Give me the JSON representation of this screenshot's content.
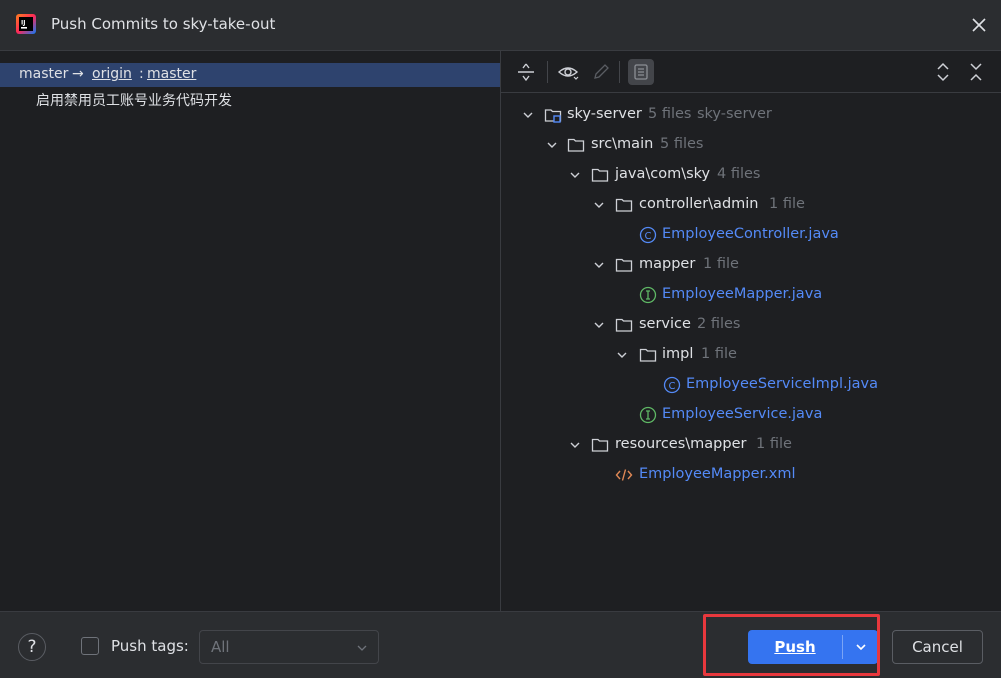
{
  "window": {
    "title": "Push Commits to sky-take-out",
    "logo_icon": "intellij-idea-logo"
  },
  "commits": {
    "branch": {
      "local": "master",
      "arrow": "→",
      "remote": "origin",
      "separator": ":",
      "remote_branch": "master"
    },
    "message": "启用禁用员工账号业务代码开发"
  },
  "toolbar": {
    "icons": [
      "collapse-to-line-icon",
      "eye-icon",
      "pencil-icon",
      "list-view-icon",
      "expand-all-icon",
      "collapse-all-icon"
    ]
  },
  "tree": {
    "module": {
      "name": "sky-server",
      "count": "5 files",
      "extra": "sky-server"
    },
    "src_main": {
      "name": "src\\main",
      "count": "5 files"
    },
    "java_pkg": {
      "name": "java\\com\\sky",
      "count": "4 files"
    },
    "controller": {
      "name": "controller\\admin",
      "count": "1 file"
    },
    "employee_controller": {
      "name": "EmployeeController.java",
      "kind": "class"
    },
    "mapper_dir": {
      "name": "mapper",
      "count": "1 file"
    },
    "employee_mapper": {
      "name": "EmployeeMapper.java",
      "kind": "interface"
    },
    "service_dir": {
      "name": "service",
      "count": "2 files"
    },
    "impl_dir": {
      "name": "impl",
      "count": "1 file"
    },
    "employee_service_impl": {
      "name": "EmployeeServiceImpl.java",
      "kind": "class"
    },
    "employee_service": {
      "name": "EmployeeService.java",
      "kind": "interface"
    },
    "resources_mapper": {
      "name": "resources\\mapper",
      "count": "1 file"
    },
    "employee_mapper_xml": {
      "name": "EmployeeMapper.xml",
      "kind": "xml"
    }
  },
  "footer": {
    "help": "?",
    "push_tags_label": "Push tags:",
    "push_tags_checked": false,
    "tags_select_value": "All",
    "push_label": "Push",
    "cancel_label": "Cancel"
  },
  "colors": {
    "accent": "#3574f0",
    "selection": "#2e436e",
    "file_link": "#548af7",
    "highlight_frame": "#e8383d",
    "class_icon": "#548af7",
    "interface_icon": "#5fb865",
    "xml_icon": "#e08855"
  }
}
